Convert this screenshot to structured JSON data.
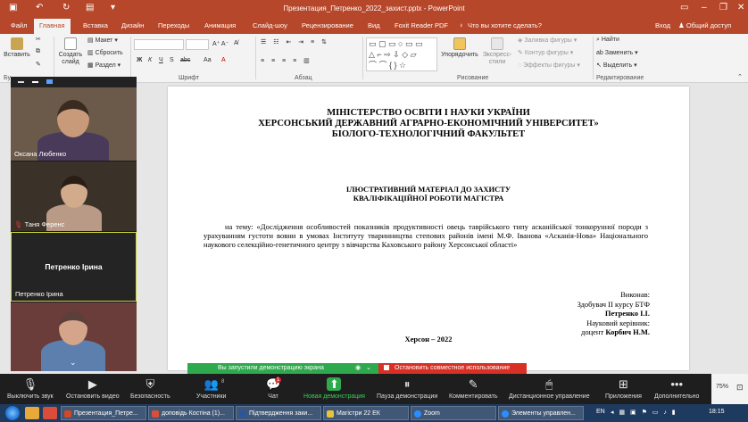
{
  "titlebar": {
    "title": "Презентация_Петренко_2022_захист.pptx - PowerPoint",
    "autosave_icon": "save-icon"
  },
  "ribbon_tabs": [
    "Файл",
    "Главная",
    "Вставка",
    "Дизайн",
    "Переходы",
    "Анимация",
    "Слайд-шоу",
    "Рецензирование",
    "Вид",
    "Foxit Reader PDF"
  ],
  "tell_me": "Что вы хотите сделать?",
  "account": {
    "login": "Вход",
    "share": "Общий доступ"
  },
  "ribbon": {
    "paste": "Вставить",
    "new_slide": "Создать слайд",
    "layout": "Макет",
    "reset": "Сбросить",
    "section": "Раздел",
    "group_font": "Шрифт",
    "group_paragraph": "Абзац",
    "arrange": "Упорядочить",
    "quick_styles": "Экспресс-стили",
    "shape_fill": "Заливка фигуры",
    "shape_outline": "Контур фигуры",
    "shape_effects": "Эффекты фигуры",
    "group_drawing": "Рисование",
    "find": "Найти",
    "replace": "Заменить",
    "select": "Выделить",
    "group_editing": "Редактирование",
    "font_buttons": [
      "Ж",
      "К",
      "Ч",
      "S",
      "abc",
      "Аа"
    ],
    "group_clipboard_partial": "Бу"
  },
  "slide": {
    "ministry": [
      "МІНІСТЕРСТВО ОСВІТИ І НАУКИ УКРАЇНИ",
      "ХЕРСОНСЬКИЙ ДЕРЖАВНИЙ АГРАРНО-ЕКОНОМІЧНИЙ УНІВЕРСИТЕТ»",
      "БІОЛОГО-ТЕХНОЛОГІЧНИЙ ФАКУЛЬТЕТ"
    ],
    "heading": [
      "ІЛЮСТРАТИВНИЙ МАТЕРІАЛ ДО ЗАХИСТУ",
      "КВАЛІФІКАЦІЙНОЇ РОБОТИ МАГІСТРА"
    ],
    "topic": "на тему: «Дослідження особливостей показників продуктивності овець таврійського типу асканійської тонкорунної породи з урахуванням густоти вовни в умовах Інституту тваринництва степових районів імені М.Ф. Іванова «Асканія-Нова» Національного наукового селекційно-генетичного центру з вівчарства Каховського району Херсонської області»",
    "executor_label": "Виконав:",
    "executor_role": "Здобувач ІІ курсу БТФ",
    "executor_name": "Петренко І.І.",
    "supervisor_label": "Науковий керівник:",
    "supervisor_prefix": "доцент",
    "supervisor_name": "Корбич Н.М.",
    "city_year": "Херсон – 2022"
  },
  "gallery": {
    "participants": [
      {
        "name": "Оксана Любенко",
        "muted": false
      },
      {
        "name": "Таня Ференс",
        "muted": true
      },
      {
        "name": "Петренко Ірина",
        "center_name": "Петренко Ірина",
        "muted": false
      },
      {
        "name": "",
        "muted": false
      }
    ]
  },
  "share_banner": {
    "status": "Вы запустили демонстрацию экрана",
    "stop": "Остановить совместное использование"
  },
  "zoom_toolbar": {
    "mute": "Выключить звук",
    "video": "Остановить видео",
    "security": "Безопасность",
    "participants": "Участники",
    "participants_count": "8",
    "chat": "Чат",
    "chat_badge": "1",
    "new_share": "Новая демонстрация",
    "pause_share": "Пауза демонстрации",
    "annotate": "Комментировать",
    "remote_control": "Дистанционное управление",
    "apps": "Приложения",
    "more": "Дополнительно"
  },
  "status": {
    "zoom": "75%"
  },
  "taskbar": {
    "items": [
      "Презентация_Петре...",
      "доповідь Костіна (1)...",
      "Підтвердження заки...",
      "Магістри 22 ЕК",
      "Zoom",
      "Элементы управлен..."
    ],
    "lang": "EN",
    "time": "18:15"
  }
}
